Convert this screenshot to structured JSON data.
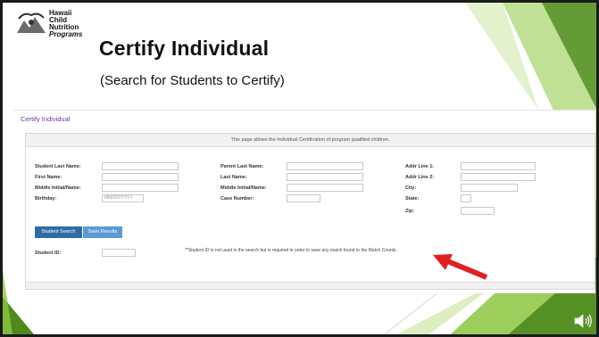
{
  "logo": {
    "line1": "Hawaii",
    "line2": "Child",
    "line3": "Nutrition",
    "line4": "Programs"
  },
  "slide": {
    "title": "Certify Individual",
    "subtitle": "(Search for Students to Certify)"
  },
  "screen": {
    "page_title": "Certify Individual",
    "panel_header": "This page allows the Individual Certification of program qualified children.",
    "fields": {
      "student_last_name": "Student Last Name:",
      "first_name": "First Name:",
      "middle_initial_name": "Middle Initial/Name:",
      "birthday": "Birthday:",
      "birthday_placeholder": "MM/DD/YYYY",
      "parent_last_name": "Parent Last Name:",
      "last_name": "Last Name:",
      "middle_initial_name_2": "Middle Initial/Name:",
      "case_number": "Case Number:",
      "addr_line_1": "Addr Line 1:",
      "addr_line_2": "Addr Line 2:",
      "city": "City:",
      "state": "State:",
      "zip": "Zip:",
      "student_id": "Student ID:"
    },
    "buttons": {
      "student_search": "Student Search",
      "save_results": "Save Results"
    },
    "note": "**Student ID is not used in the search but is required in order to save any match found to the Match Counts."
  },
  "colors": {
    "green_dark": "#4e8a1e",
    "green_light": "#8cc63f",
    "link_purple": "#6b3aa0",
    "button_blue": "#2e6da4",
    "arrow_red": "#e02020"
  },
  "icons": {
    "speaker": "speaker-icon",
    "arrow": "red-arrow-icon"
  }
}
